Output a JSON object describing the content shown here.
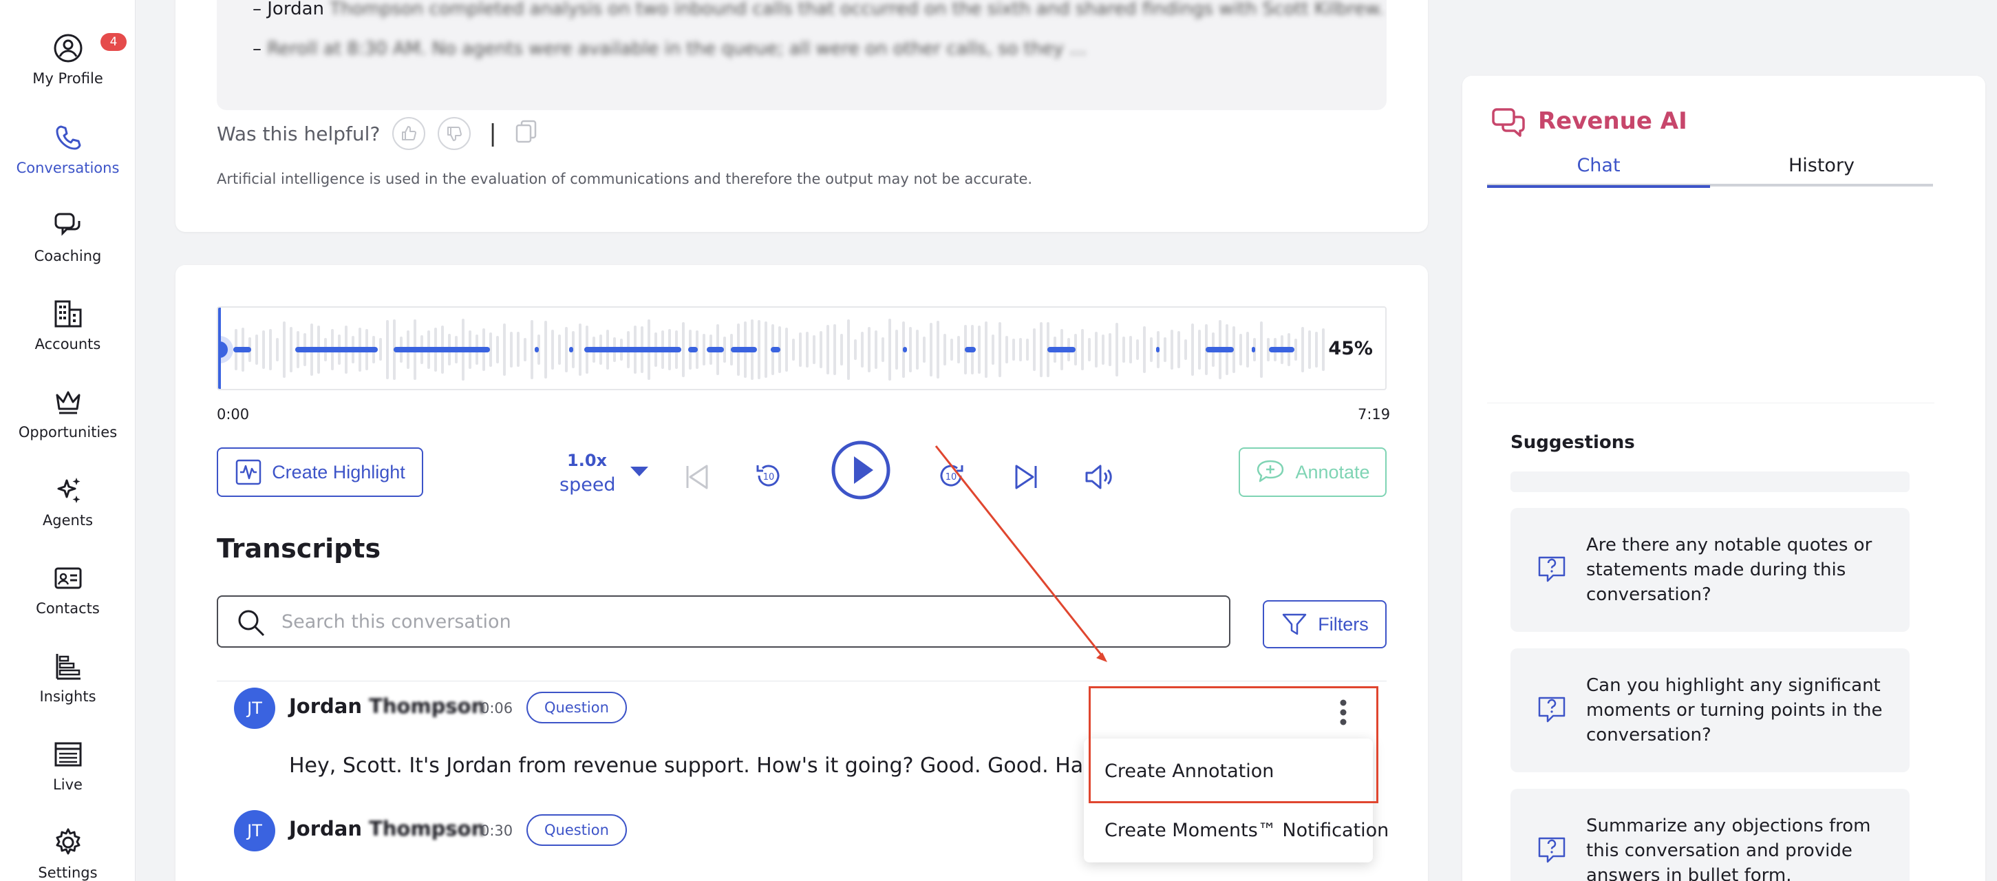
{
  "sidebar": {
    "items": [
      {
        "label": "My Profile",
        "icon": "user-circle-icon",
        "badge": "4"
      },
      {
        "label": "Conversations",
        "icon": "phone-icon",
        "active": true
      },
      {
        "label": "Coaching",
        "icon": "chat-bubbles-icon"
      },
      {
        "label": "Accounts",
        "icon": "building-icon"
      },
      {
        "label": "Opportunities",
        "icon": "crown-icon"
      },
      {
        "label": "Agents",
        "icon": "sparkles-icon"
      },
      {
        "label": "Contacts",
        "icon": "id-card-icon"
      },
      {
        "label": "Insights",
        "icon": "bar-chart-icon"
      },
      {
        "label": "Live",
        "icon": "list-icon"
      },
      {
        "label": "Settings",
        "icon": "gear-icon"
      }
    ],
    "active_color": "#3d54c8"
  },
  "summary": {
    "line1_prefix": "– Jordan",
    "line1_blurred": " Thompson completed analysis on two inbound calls that occurred on the sixth and shared findings with Scott Kilbrew.",
    "line2_prefix": "– ",
    "line2_blurred": "Reroll at 8:30 AM. No agents were available in the queue; all were on other calls, so they ...",
    "helpful_label": "Was this helpful?",
    "separator": "|",
    "disclaimer": "Artificial intelligence is used in the evaluation of communications and therefore the output may not be accurate."
  },
  "player": {
    "progress_percent": 45,
    "progress_label": "45%",
    "time_start": "0:00",
    "time_end": "7:19",
    "create_highlight_label": "Create Highlight",
    "speed_value": "1.0x",
    "speed_label": "speed",
    "annotate_label": "Annotate",
    "skip_seconds": "10"
  },
  "transcripts": {
    "title": "Transcripts",
    "search_placeholder": "Search this conversation",
    "filters_label": "Filters",
    "rows": [
      {
        "initials": "JT",
        "speaker": "Jordan",
        "speaker_blurred": " Thompson",
        "time": "0:06",
        "tag": "Question",
        "text": "Hey, Scott. It's Jordan from revenue support. How's it going? Good. Good. Having a g"
      },
      {
        "initials": "JT",
        "speaker": "Jordan",
        "speaker_blurred": " Thompson",
        "time": "0:30",
        "tag": "Question",
        "text": ""
      }
    ]
  },
  "context_menu": {
    "items": [
      "Create Annotation",
      "Create Moments™ Notification"
    ]
  },
  "ai_panel": {
    "title": "Revenue AI",
    "tabs": [
      "Chat",
      "History"
    ],
    "active_tab": "Chat",
    "suggestions_title": "Suggestions",
    "suggestions": [
      "Are there any notable quotes or statements made during this conversation?",
      "Can you highlight any significant moments or turning points in the conversation?",
      "Summarize any objections from this conversation and provide answers in bullet form."
    ],
    "title_color": "#c7466b"
  },
  "colors": {
    "accent": "#3d54c8",
    "waveform_played": "#3a63e0",
    "annotate_green": "#7fd4b4",
    "annotation_red": "#e0462f"
  }
}
